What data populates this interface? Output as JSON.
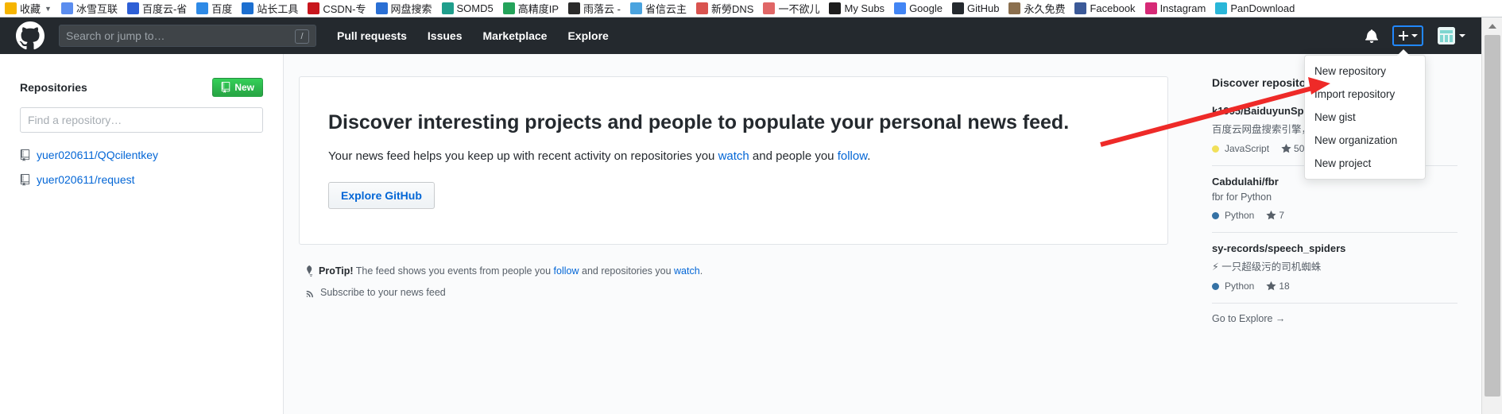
{
  "browser": {
    "bookmarks": [
      {
        "label": "收藏",
        "icon": "star-favicon",
        "color": "#f5b400",
        "caret": true
      },
      {
        "label": "冰雪互联",
        "icon": "site-favicon",
        "color": "#5b8def",
        "caret": false
      },
      {
        "label": "百度云-省",
        "icon": "baiduyun-favicon",
        "color": "#2d5fd6",
        "caret": false
      },
      {
        "label": "百度",
        "icon": "baidu-favicon",
        "color": "#2e8ae6",
        "caret": false
      },
      {
        "label": "站长工具",
        "icon": "chinaz-favicon",
        "color": "#1c6fd0",
        "caret": false
      },
      {
        "label": "CSDN-专",
        "icon": "csdn-favicon",
        "color": "#c8161d",
        "caret": false
      },
      {
        "label": "网盘搜索",
        "icon": "pansearch-favicon",
        "color": "#2a6fd4",
        "caret": false
      },
      {
        "label": "SOMD5",
        "icon": "somd5-favicon",
        "color": "#1f9e8c",
        "caret": false
      },
      {
        "label": "高精度IP",
        "icon": "ip-favicon",
        "color": "#24a35a",
        "caret": false
      },
      {
        "label": "雨落云 -",
        "icon": "yuluoyun-favicon",
        "color": "#2b2b2b",
        "caret": false
      },
      {
        "label": "省信云主",
        "icon": "cloudhost-favicon",
        "color": "#4aa3df",
        "caret": false
      },
      {
        "label": "新勞DNS",
        "icon": "dns-favicon",
        "color": "#d9534f",
        "caret": false
      },
      {
        "label": "一不欲儿",
        "icon": "misc-favicon",
        "color": "#e06666",
        "caret": false
      },
      {
        "label": "My Subs",
        "icon": "check-favicon",
        "color": "#1d1d1d",
        "caret": false
      },
      {
        "label": "Google",
        "icon": "google-favicon",
        "color": "#4285f4",
        "caret": false
      },
      {
        "label": "GitHub",
        "icon": "github-favicon",
        "color": "#24292e",
        "caret": false
      },
      {
        "label": "永久免费",
        "icon": "free-favicon",
        "color": "#8b6f4e",
        "caret": false
      },
      {
        "label": "Facebook",
        "icon": "facebook-favicon",
        "color": "#3b5998",
        "caret": false
      },
      {
        "label": "Instagram",
        "icon": "instagram-favicon",
        "color": "#d62976",
        "caret": false
      },
      {
        "label": "PanDownload",
        "icon": "pandownload-favicon",
        "color": "#29b6d8",
        "caret": false
      }
    ]
  },
  "header": {
    "logo": "github-mark-icon",
    "search": {
      "placeholder": "Search or jump to…",
      "value": "",
      "shortcut_key": "/"
    },
    "nav": [
      {
        "label": "Pull requests"
      },
      {
        "label": "Issues"
      },
      {
        "label": "Marketplace"
      },
      {
        "label": "Explore"
      }
    ],
    "notifications_icon": "bell-icon",
    "create_new_icon": "plus-icon",
    "avatar": "user-avatar",
    "focus_color": "#2188ff"
  },
  "create_menu": {
    "open": true,
    "items": [
      {
        "label": "New repository"
      },
      {
        "label": "Import repository"
      },
      {
        "label": "New gist"
      },
      {
        "label": "New organization"
      },
      {
        "label": "New project"
      }
    ]
  },
  "sidebar": {
    "title": "Repositories",
    "new_button": {
      "label": "New",
      "icon": "repo-icon",
      "color": "#28a745"
    },
    "filter": {
      "placeholder": "Find a repository…",
      "value": ""
    },
    "repos": [
      {
        "name": "yuer020611/QQcilentkey",
        "icon": "repo-icon"
      },
      {
        "name": "yuer020611/request",
        "icon": "repo-icon"
      }
    ]
  },
  "main": {
    "title": "Discover interesting projects and people to populate your personal news feed.",
    "subtitle_pre": "Your news feed helps you keep up with recent activity on repositories you ",
    "subtitle_link1": "watch",
    "subtitle_mid": " and people you ",
    "subtitle_link2": "follow",
    "subtitle_post": ".",
    "explore_button": "Explore GitHub",
    "protip_icon": "lightbulb-icon",
    "protip_label": "ProTip!",
    "protip_pre": " The feed shows you events from people you ",
    "protip_link1": "follow",
    "protip_mid": " and repositories you ",
    "protip_link2": "watch",
    "protip_post": ".",
    "subscribe_icon": "rss-icon",
    "subscribe_label": "Subscribe to your news feed"
  },
  "discover": {
    "title": "Discover repositories",
    "items": [
      {
        "name": "k1995/BaiduyunSpider",
        "description": "百度云网盘搜索引擎，包",
        "language": "JavaScript",
        "language_color": "#f1e05a",
        "stars": "502",
        "star_icon": "star-icon"
      },
      {
        "name": "Cabdulahi/fbr",
        "description": "fbr for Python",
        "language": "Python",
        "language_color": "#3572A5",
        "stars": "7",
        "star_icon": "star-icon"
      },
      {
        "name": "sy-records/speech_spiders",
        "description": "⚡ 一只超级污的司机蜘蛛",
        "language": "Python",
        "language_color": "#3572A5",
        "stars": "18",
        "star_icon": "star-icon"
      }
    ],
    "go_to_explore": "Go to Explore →"
  },
  "annotation": {
    "arrow_color": "#ee2a28",
    "points_to": "New repository"
  },
  "scrollbar": {
    "up_arrow_icon": "caret-up-icon"
  }
}
